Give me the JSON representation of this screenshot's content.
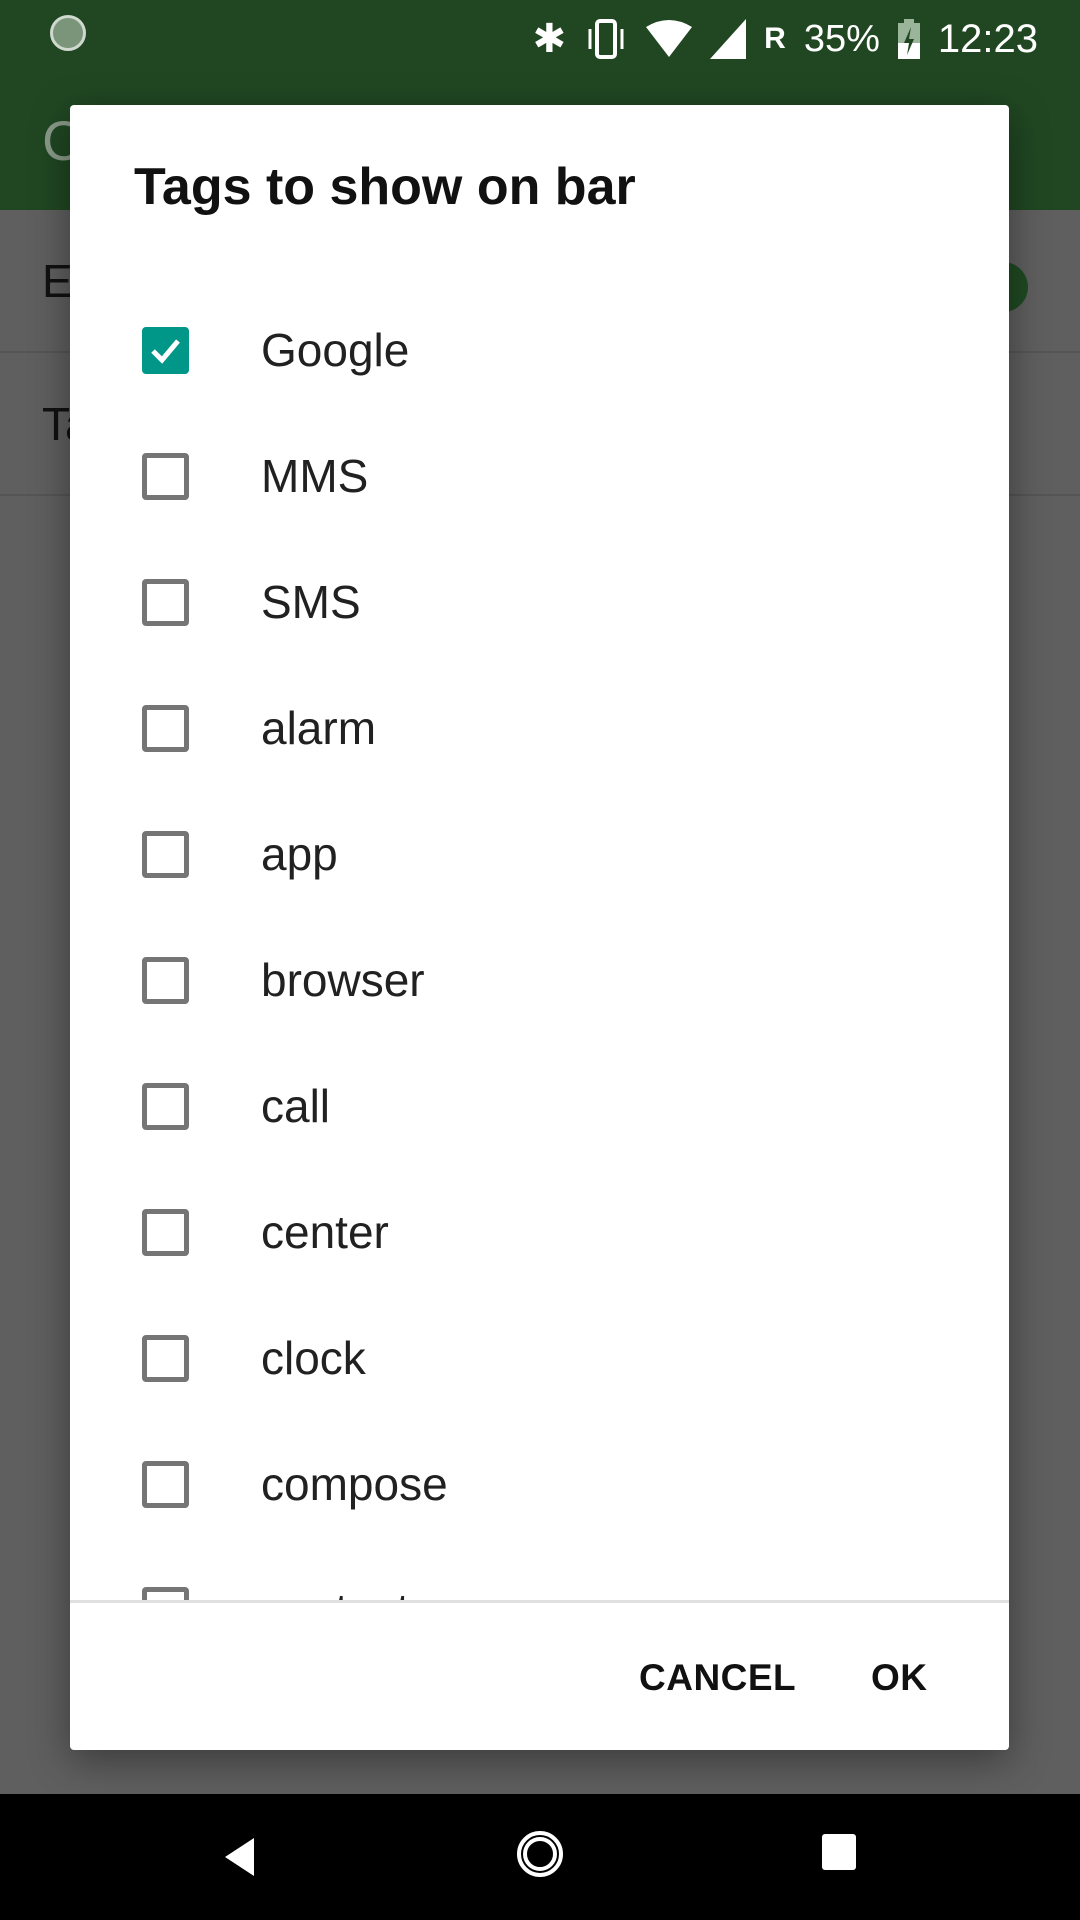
{
  "status_bar": {
    "time": "12:23",
    "battery": "35%",
    "network": "R",
    "icons": [
      "sync-icon",
      "bluetooth-icon",
      "vibrate-icon",
      "wifi-icon",
      "signal-icon",
      "battery-charging-icon"
    ]
  },
  "background": {
    "app_title_partial": "C",
    "rows": [
      {
        "label_partial": "En"
      },
      {
        "label_partial": "Ta"
      }
    ],
    "accent": "#204722"
  },
  "dialog": {
    "title": "Tags to show on bar",
    "items": [
      {
        "label": "Google",
        "checked": true
      },
      {
        "label": "MMS",
        "checked": false
      },
      {
        "label": "SMS",
        "checked": false
      },
      {
        "label": "alarm",
        "checked": false
      },
      {
        "label": "app",
        "checked": false
      },
      {
        "label": "browser",
        "checked": false
      },
      {
        "label": "call",
        "checked": false
      },
      {
        "label": "center",
        "checked": false
      },
      {
        "label": "clock",
        "checked": false
      },
      {
        "label": "compose",
        "checked": false
      },
      {
        "label": "contacts",
        "checked": false
      }
    ],
    "cancel_label": "CANCEL",
    "ok_label": "OK",
    "checkbox_color": "#009688"
  },
  "nav_bar": {
    "icons": [
      "back-icon",
      "home-icon",
      "recents-icon"
    ]
  }
}
